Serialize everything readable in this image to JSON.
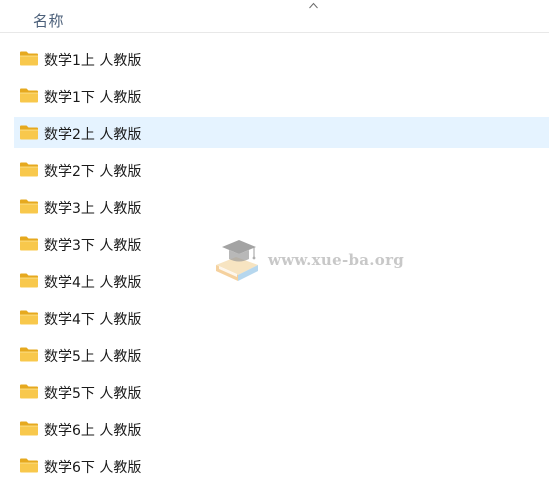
{
  "header": {
    "column_name": "名称"
  },
  "list": {
    "items": [
      {
        "label": "数学1上 人教版"
      },
      {
        "label": "数学1下 人教版"
      },
      {
        "label": "数学2上 人教版"
      },
      {
        "label": "数学2下 人教版"
      },
      {
        "label": "数学3上 人教版"
      },
      {
        "label": "数学3下 人教版"
      },
      {
        "label": "数学4上 人教版"
      },
      {
        "label": "数学4下 人教版"
      },
      {
        "label": "数学5上 人教版"
      },
      {
        "label": "数学5下 人教版"
      },
      {
        "label": "数学6上 人教版"
      },
      {
        "label": "数学6下 人教版"
      }
    ],
    "selected_index": 2
  },
  "watermark": {
    "text": "www.xue-ba.org"
  },
  "icons": {
    "folder": "folder-icon",
    "sort": "sort-ascending-icon",
    "watermark_logo": "graduation-cap-book-icon"
  },
  "colors": {
    "selection": "#e5f3ff",
    "folder": "#f8c84c"
  }
}
